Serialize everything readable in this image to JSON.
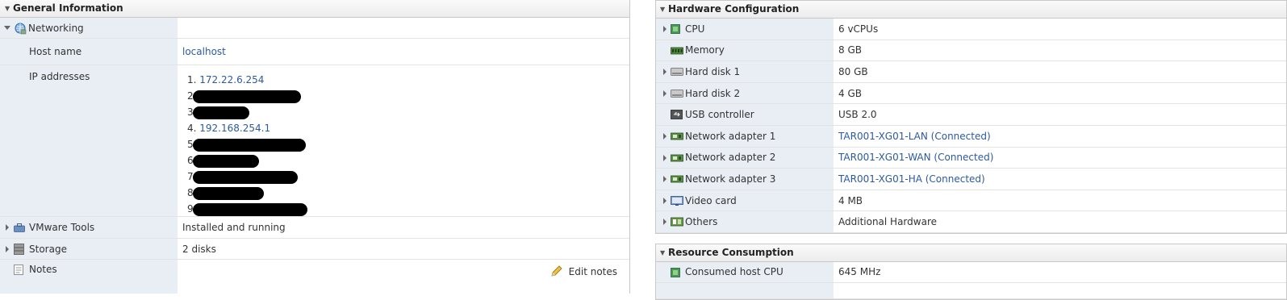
{
  "general": {
    "title": "General Information",
    "networking": "Networking",
    "host_name_label": "Host name",
    "host_name": "localhost",
    "ip_label": "IP addresses",
    "ips": [
      {
        "num": "1.",
        "value": "172.22.6.254"
      },
      {
        "num": "2.",
        "value": ""
      },
      {
        "num": "3.",
        "value": ""
      },
      {
        "num": "4.",
        "value": "192.168.254.1"
      },
      {
        "num": "5.",
        "value": ""
      },
      {
        "num": "6.",
        "value": ""
      },
      {
        "num": "7.",
        "value": ""
      },
      {
        "num": "8.",
        "value": ""
      },
      {
        "num": "9.",
        "value": ""
      }
    ],
    "vmware_tools_label": "VMware Tools",
    "vmware_tools_value": "Installed and running",
    "storage_label": "Storage",
    "storage_value": "2 disks",
    "notes_label": "Notes",
    "edit_notes": "Edit notes"
  },
  "hardware": {
    "title": "Hardware Configuration",
    "rows": [
      {
        "label": "CPU",
        "value": "6 vCPUs",
        "link": false,
        "icon": "cpu-icon"
      },
      {
        "label": "Memory",
        "value": "8 GB",
        "link": false,
        "icon": "memory-icon"
      },
      {
        "label": "Hard disk 1",
        "value": "80 GB",
        "link": false,
        "icon": "hard-disk-icon"
      },
      {
        "label": "Hard disk 2",
        "value": "4 GB",
        "link": false,
        "icon": "hard-disk-icon"
      },
      {
        "label": "USB controller",
        "value": "USB 2.0",
        "link": false,
        "icon": "usb-icon"
      },
      {
        "label": "Network adapter 1",
        "value": "TAR001-XG01-LAN (Connected)",
        "link": true,
        "icon": "network-adapter-icon"
      },
      {
        "label": "Network adapter 2",
        "value": "TAR001-XG01-WAN (Connected)",
        "link": true,
        "icon": "network-adapter-icon"
      },
      {
        "label": "Network adapter 3",
        "value": "TAR001-XG01-HA (Connected)",
        "link": true,
        "icon": "network-adapter-icon"
      },
      {
        "label": "Video card",
        "value": "4 MB",
        "link": false,
        "icon": "video-card-icon"
      },
      {
        "label": "Others",
        "value": "Additional Hardware",
        "link": false,
        "icon": "others-icon"
      }
    ]
  },
  "resource": {
    "title": "Resource Consumption",
    "consumed_cpu_label": "Consumed host CPU",
    "consumed_cpu_value": "645 MHz"
  }
}
